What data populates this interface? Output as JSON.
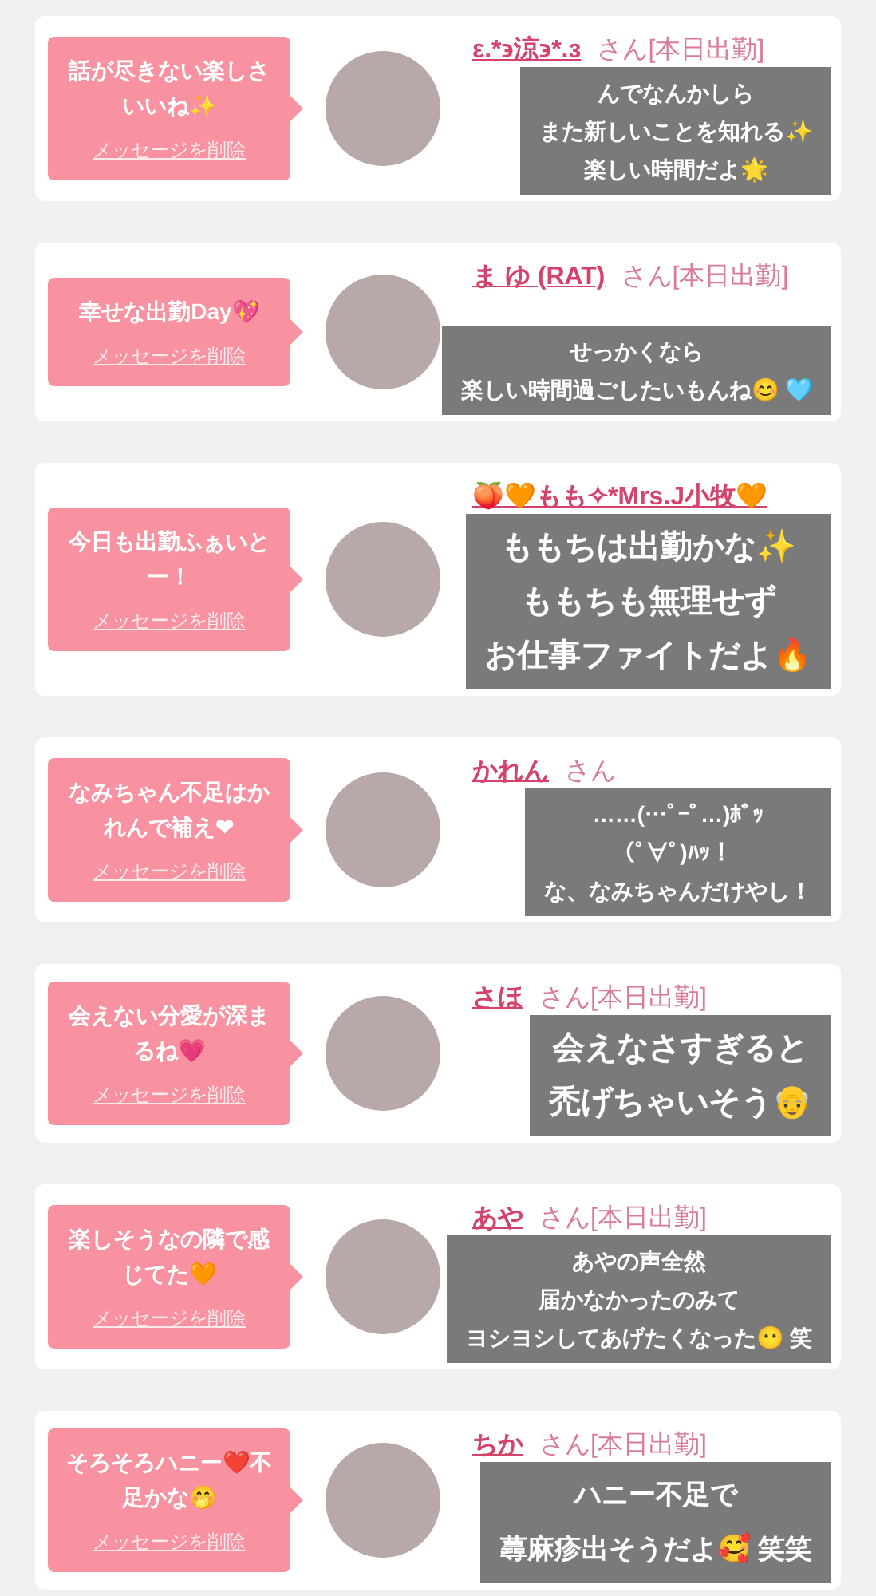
{
  "cards": [
    {
      "message": "話が尽きない楽しさいいね✨",
      "delete_label": "メッセージを削除",
      "name": "ε.*϶涼϶*.ɜ",
      "suffix": "さん[本日出勤]",
      "overlay": {
        "kind": "small",
        "lines": [
          "んでなんかしら",
          "また新しいことを知れる✨",
          "楽しい時間だよ🌟"
        ]
      }
    },
    {
      "message": "幸せな出勤Day💖",
      "delete_label": "メッセージを削除",
      "name": "ま ゆ (RAT)",
      "suffix": "さん[本日出勤]",
      "overlay": {
        "kind": "small",
        "lines": [
          "せっかくなら",
          "楽しい時間過ごしたいもんね😊 🩵"
        ]
      }
    },
    {
      "message": "今日も出勤ふぁいとー！",
      "delete_label": "メッセージを削除",
      "name": "🍑🧡もも✧*Mrs.J小牧🧡",
      "overlay": {
        "kind": "large",
        "lines": [
          "ももちは出勤かな✨",
          "ももちも無理せず",
          "お仕事ファイトだよ🔥"
        ]
      }
    },
    {
      "message": "なみちゃん不足はかれんで補え❤",
      "delete_label": "メッセージを削除",
      "name": "かれん",
      "suffix": "さん",
      "overlay": {
        "kind": "small",
        "lines": [
          "……(…ﾟ-ﾟ…)ﾎﾞｯ",
          "(ﾟ∀ﾟ)ﾊｯ！",
          "な、なみちゃんだけやし！"
        ]
      }
    },
    {
      "message": "会えない分愛が深まるね💗",
      "delete_label": "メッセージを削除",
      "name": "さほ",
      "suffix": "さん[本日出勤]",
      "overlay": {
        "kind": "large",
        "lines": [
          "会えなさすぎると",
          "禿げちゃいそう👴"
        ]
      }
    },
    {
      "message": "楽しそうなの隣で感じてた🧡",
      "delete_label": "メッセージを削除",
      "name": "あや",
      "suffix": "さん[本日出勤]",
      "overlay": {
        "kind": "small",
        "lines": [
          "あやの声全然",
          "届かなかったのみて",
          "ヨシヨシしてあげたくなった😶 笑"
        ]
      }
    },
    {
      "message": "そろそろハニー❤️不足かな🤭",
      "delete_label": "メッセージを削除",
      "name": "ちか",
      "suffix": "さん[本日出勤]",
      "overlay": {
        "kind": "medium",
        "lines": [
          "ハニー不足で",
          "蕁麻疹出そうだよ🥰 笑笑"
        ]
      }
    }
  ]
}
